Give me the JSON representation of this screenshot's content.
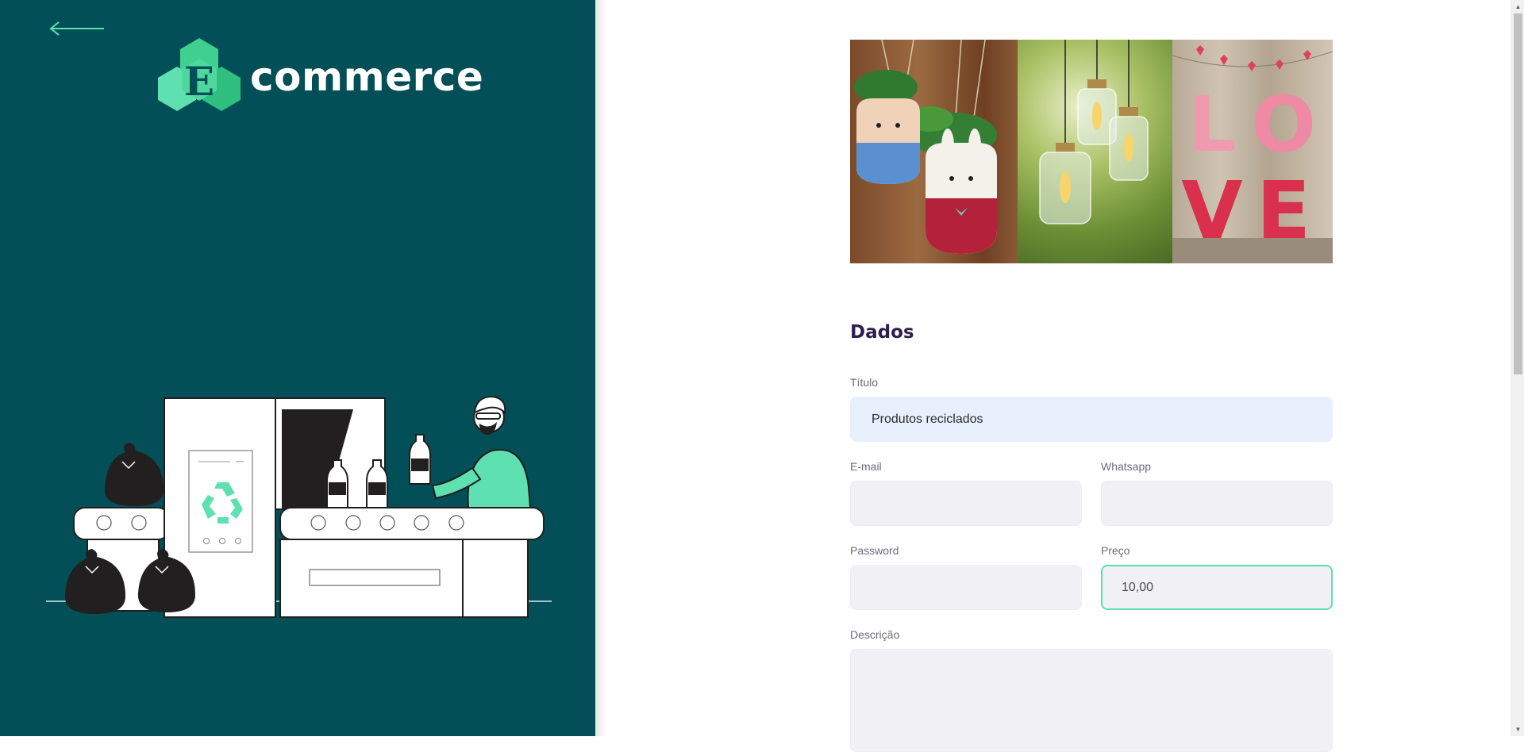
{
  "brand": {
    "logo_letter": "E",
    "name": "commerce"
  },
  "nav": {
    "back_icon": "arrow-left-icon"
  },
  "illustration": {
    "description_icon": "recycling-machine-illustration"
  },
  "hero_image": {
    "love_letters": [
      "L",
      "O",
      "V",
      "E"
    ]
  },
  "form": {
    "section_title": "Dados",
    "fields": {
      "title": {
        "label": "Título",
        "value": "Produtos reciclados",
        "placeholder": ""
      },
      "email": {
        "label": "E-mail",
        "value": "",
        "placeholder": ""
      },
      "whatsapp": {
        "label": "Whatsapp",
        "value": "",
        "placeholder": ""
      },
      "password": {
        "label": "Password",
        "value": "",
        "placeholder": ""
      },
      "price": {
        "label": "Preço",
        "value": "10,00",
        "placeholder": ""
      },
      "description": {
        "label": "Descrição",
        "value": "",
        "placeholder": ""
      }
    }
  },
  "colors": {
    "left_panel_bg": "#034F57",
    "accent_green": "#5FE0B0",
    "title_purple": "#2D1E4E",
    "input_bg": "#F0F0F5",
    "autofill_bg": "#E8F0FE"
  }
}
